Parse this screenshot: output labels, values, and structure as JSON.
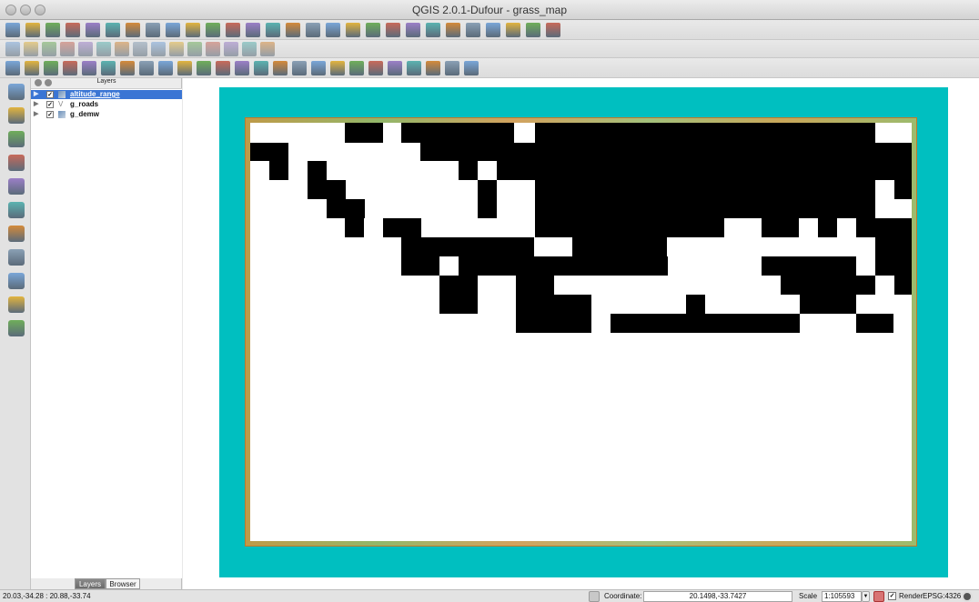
{
  "window": {
    "title": "QGIS 2.0.1-Dufour - grass_map"
  },
  "toolbars": {
    "file": [
      "new-project-icon",
      "open-project-icon",
      "save-project-icon",
      "save-as-icon",
      "new-print-composer-icon",
      "composer-manager-icon"
    ],
    "navigation": [
      "pan-icon",
      "pan-to-selection-icon",
      "zoom-in-icon",
      "zoom-out-icon",
      "zoom-full-icon",
      "zoom-to-layer-icon",
      "zoom-to-selection-icon",
      "zoom-last-icon",
      "zoom-next-icon",
      "refresh-icon"
    ],
    "attributes": [
      "identify-icon",
      "select-icon",
      "deselect-icon",
      "attribute-table-icon",
      "field-calculator-icon",
      "measure-icon",
      "map-tips-icon",
      "bookmark-icon",
      "text-annotation-icon",
      "label-icon",
      "help-icon",
      "whats-this-icon"
    ],
    "digitizing": [
      "current-edits-icon",
      "toggle-editing-icon",
      "save-edits-icon",
      "add-feature-icon",
      "move-feature-icon",
      "node-tool-icon",
      "delete-selected-icon",
      "cut-features-icon",
      "copy-features-icon",
      "paste-features-icon",
      "label-pin-icon",
      "label-show-icon",
      "label-move-icon",
      "label-rotate-icon",
      "label-change-icon"
    ],
    "advanced_digitizing": [
      "undo-icon",
      "redo-icon",
      "rotate-feature-icon",
      "simplify-feature-icon",
      "add-ring-icon",
      "add-part-icon",
      "fill-ring-icon",
      "delete-ring-icon",
      "delete-part-icon",
      "reshape-icon",
      "offset-curve-icon",
      "split-features-icon",
      "split-parts-icon",
      "merge-features-icon",
      "merge-attributes-icon",
      "rotate-point-symbols-icon",
      "grass-mapset-icon",
      "grass-open-icon",
      "grass-close-icon",
      "grass-new-vector-icon",
      "grass-edit-icon",
      "grass-tools-icon",
      "grass-region-icon",
      "grass-edit-region-icon",
      "grass-display-icon"
    ]
  },
  "left_toolbar": [
    "add-vector-layer-icon",
    "add-raster-layer-icon",
    "add-postgis-layer-icon",
    "add-spatialite-layer-icon",
    "add-mssql-layer-icon",
    "add-wms-layer-icon",
    "add-wcs-layer-icon",
    "add-wfs-layer-icon",
    "add-delimited-text-icon",
    "new-shapefile-icon",
    "remove-layer-icon"
  ],
  "layers_panel": {
    "title": "Layers",
    "layers": [
      {
        "name": "altitude_range",
        "checked": true,
        "selected": true,
        "type": "raster"
      },
      {
        "name": "g_roads",
        "checked": true,
        "selected": false,
        "type": "vector"
      },
      {
        "name": "g_demw",
        "checked": true,
        "selected": false,
        "type": "raster"
      }
    ],
    "tabs": [
      {
        "label": "Layers",
        "active": true
      },
      {
        "label": "Browser",
        "active": false
      }
    ]
  },
  "status": {
    "extent": "20.03,-34.28 : 20.88,-33.74",
    "coordinate_label": "Coordinate:",
    "coordinate": "20.1498,-33.7427",
    "scale_label": "Scale",
    "scale": "1:105593",
    "render_label": "Render",
    "render_checked": true,
    "crs": "EPSG:4326"
  },
  "colors": {
    "map_background": "#00bfc0",
    "raster_high": "#000000",
    "raster_low": "#ffffff",
    "selection": "#3a75d4"
  }
}
